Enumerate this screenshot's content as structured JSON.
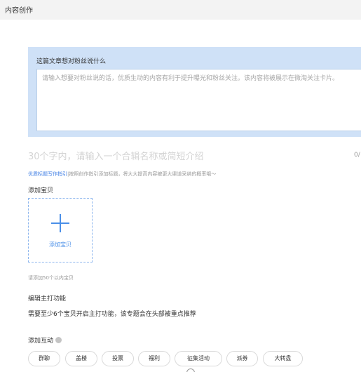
{
  "header": {
    "title": "内容创作"
  },
  "fans_message": {
    "label": "这篇文章想对粉丝说什么",
    "placeholder": "请输入想要对粉丝说的话，优质生动的内容有利于提升曝光和粉丝关注。该内容将被展示在微淘关注卡片。"
  },
  "title_field": {
    "placeholder": "30个字内，请输入一个合辑名称或简短介绍",
    "count": "0/"
  },
  "tip": {
    "link": "优质标题写作指引",
    "text": "|按照创作指引添加标题，将大大提高内容被更大渠道采纳的概率哦～"
  },
  "goods": {
    "label": "添加宝贝",
    "add_button": "添加宝贝",
    "limit_hint": "请添加50个以内宝贝"
  },
  "main_feature": {
    "label": "编辑主打功能",
    "description": "需要至少6个宝贝开启主打功能，该专题会在头部被重点推荐"
  },
  "interaction": {
    "label": "添加互动",
    "options": [
      "群聊",
      "盖楼",
      "投票",
      "福利",
      "征集活动",
      "派券",
      "大转盘"
    ]
  },
  "colors": {
    "accent": "#4a8fe8",
    "panel_bg": "#cfe1f7",
    "link": "#3e7de4"
  }
}
